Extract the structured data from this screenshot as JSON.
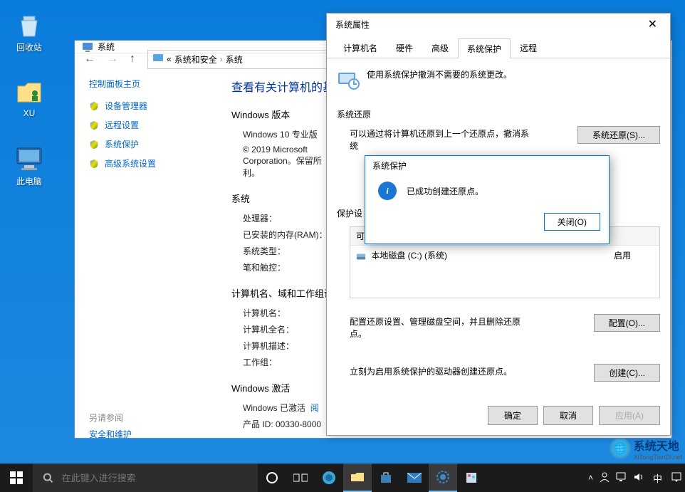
{
  "desktop": {
    "icons": [
      {
        "name": "recycle-bin",
        "label": "回收站"
      },
      {
        "name": "folder-xu",
        "label": "XU"
      },
      {
        "name": "this-pc",
        "label": "此电脑"
      }
    ]
  },
  "system_window": {
    "title": "系统",
    "breadcrumb": {
      "part1": "系统和安全",
      "part2": "系统",
      "sep": "›",
      "prefix": "«"
    },
    "sidebar": {
      "home": "控制面板主页",
      "items": [
        "设备管理器",
        "远程设置",
        "系统保护",
        "高级系统设置"
      ],
      "see_also": "另请参阅",
      "see_also_link": "安全和维护"
    },
    "main": {
      "heading": "查看有关计算机的基",
      "edition_title": "Windows 版本",
      "edition_value": "Windows 10 专业版",
      "copyright": "© 2019 Microsoft Corporation。保留所利。",
      "system_title": "系统",
      "rows": {
        "cpu": "处理器：",
        "ram": "已安装的内存(RAM)：",
        "type": "系统类型：",
        "pen": "笔和触控："
      },
      "computer_title": "计算机名、域和工作组设",
      "computer_rows": {
        "name": "计算机名：",
        "full": "计算机全名：",
        "desc": "计算机描述：",
        "wg": "工作组："
      },
      "activation_title": "Windows 激活",
      "activation_status": "Windows 已激活",
      "activation_link": "阅",
      "product_id": "产品 ID: 00330-8000"
    }
  },
  "props_dialog": {
    "title": "系统属性",
    "tabs": [
      "计算机名",
      "硬件",
      "高级",
      "系统保护",
      "远程"
    ],
    "active_tab": 3,
    "intro": "使用系统保护撤消不需要的系统更改。",
    "restore_label": "系统还原",
    "restore_desc": "可以通过将计算机还原到上一个还原点，撤消系统",
    "restore_btn": "系统还原(S)...",
    "settings_label": "保护设",
    "drives_header": "可",
    "drive_row": {
      "name": "本地磁盘 (C:) (系统)",
      "status": "启用"
    },
    "config_desc": "配置还原设置、管理磁盘空间，并且删除还原点。",
    "config_btn": "配置(O)...",
    "create_desc": "立刻为启用系统保护的驱动器创建还原点。",
    "create_btn": "创建(C)...",
    "ok": "确定",
    "cancel": "取消",
    "apply": "应用(A)"
  },
  "msg_dialog": {
    "title": "系统保护",
    "message": "已成功创建还原点。",
    "close": "关闭(O)"
  },
  "taskbar": {
    "search_placeholder": "在此键入进行搜索",
    "ime": "中"
  },
  "watermark": {
    "title": "系统天地",
    "sub": "XiTongTianDi.net"
  }
}
